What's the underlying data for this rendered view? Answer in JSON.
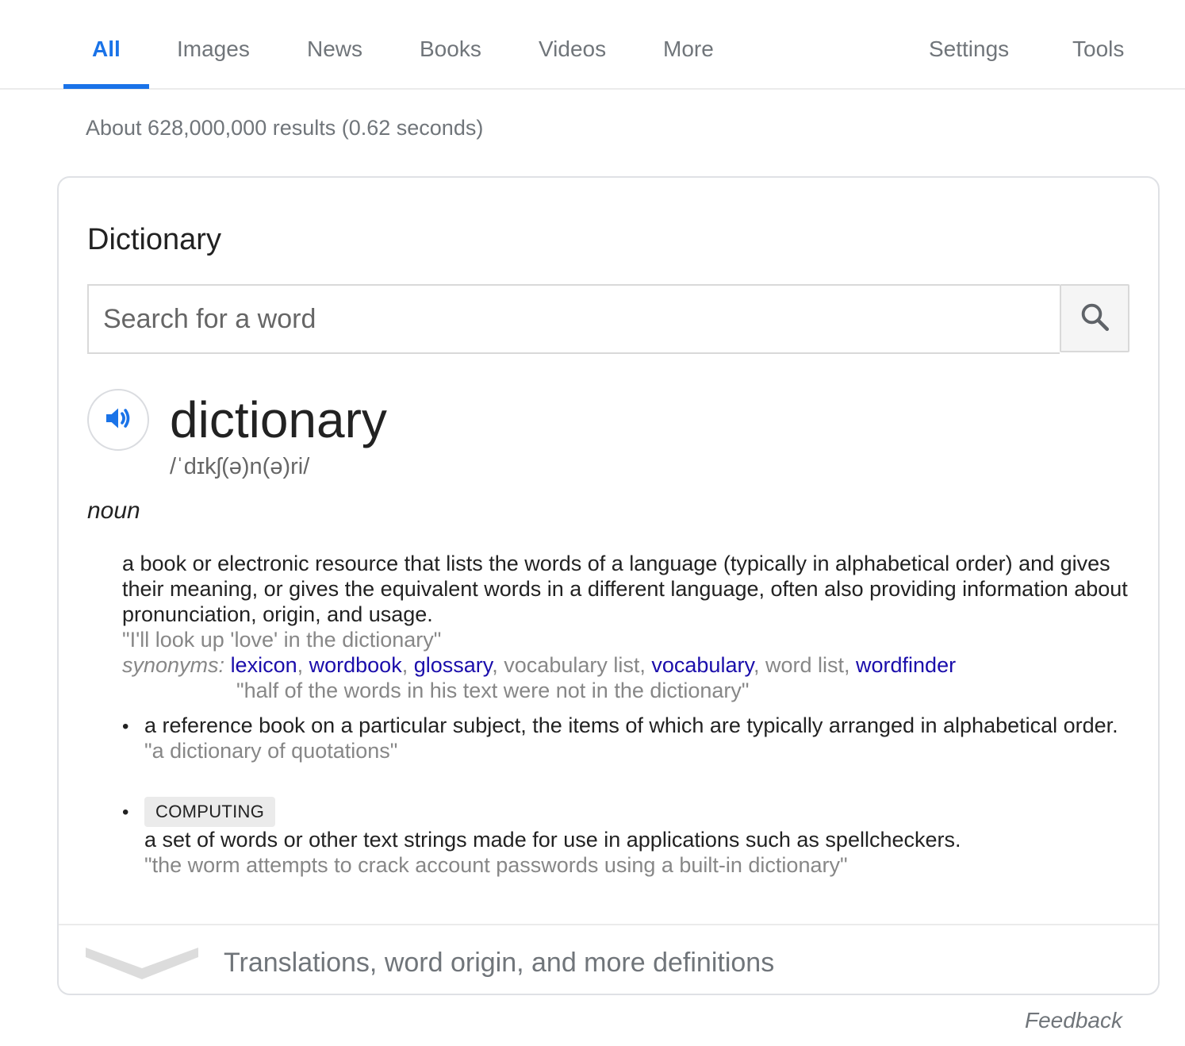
{
  "nav": {
    "tabs": [
      {
        "label": "All",
        "active": true
      },
      {
        "label": "Images"
      },
      {
        "label": "News"
      },
      {
        "label": "Books"
      },
      {
        "label": "Videos"
      },
      {
        "label": "More"
      }
    ],
    "right": [
      {
        "label": "Settings"
      },
      {
        "label": "Tools"
      }
    ],
    "accent_color": "#1a73e8"
  },
  "stats": "About 628,000,000 results (0.62 seconds)",
  "dictionary": {
    "title": "Dictionary",
    "search": {
      "placeholder": "Search for a word",
      "value": "",
      "icon": "search-icon"
    },
    "speaker_icon": "speaker-icon",
    "headword": "dictionary",
    "phonetic": "/ˈdɪkʃ(ə)n(ə)ri/",
    "part_of_speech": "noun",
    "definitions": [
      {
        "text": "a book or electronic resource that lists the words of a language (typically in alphabetical order) and gives their meaning, or gives the equivalent words in a different language, often also providing information about pronunciation, origin, and usage.",
        "example": "\"I'll look up 'love' in the dictionary\"",
        "synonyms_label": "synonyms:",
        "synonyms": [
          {
            "word": "lexicon",
            "link": true
          },
          {
            "word": "wordbook",
            "link": true
          },
          {
            "word": "glossary",
            "link": true
          },
          {
            "word": "vocabulary list",
            "link": false
          },
          {
            "word": "vocabulary",
            "link": true
          },
          {
            "word": "word list",
            "link": false
          },
          {
            "word": "wordfinder",
            "link": true
          }
        ],
        "synonym_example": "\"half of the words in his text were not in the dictionary\""
      },
      {
        "bullet": "•",
        "text": "a reference book on a particular subject, the items of which are typically arranged in alphabetical order.",
        "example": "\"a dictionary of quotations\""
      },
      {
        "bullet": "•",
        "tag": "COMPUTING",
        "text": "a set of words or other text strings made for use in applications such as spellcheckers.",
        "example": "\"the worm attempts to crack account passwords using a built-in dictionary\""
      }
    ],
    "more_label": "Translations, word origin, and more definitions",
    "chevron_icon": "chevron-down-icon"
  },
  "feedback": "Feedback"
}
